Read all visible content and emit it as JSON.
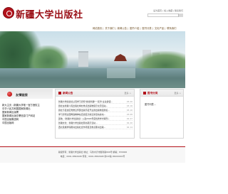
{
  "header": {
    "logo_text": "新疆大学出版社",
    "top_links": "设为首页 | 加入收藏 | 联系我们",
    "search_placeholder": ""
  },
  "nav": {
    "items": [
      "网站首页",
      "关于我们",
      "新闻公告",
      "图书介绍",
      "图书分类",
      "文化产品",
      "联系我们"
    ]
  },
  "left": {
    "title": "友情链接",
    "links": [
      "新大主页（新疆大学唯一官方授权主",
      "中华人民共和国国家新闻出",
      "国家新闻出版署",
      "国家新闻出版总署信息门户网站",
      "中国出版集团网",
      "中国出版网"
    ]
  },
  "news": {
    "title": "新闻公告",
    "more": "更多 >",
    "items": [
      {
        "title": "新疆大学出版社认真学习贯彻\"健康新疆\"一系列\"主旨讲话...",
        "date": "03.20"
      },
      {
        "title": "我社在新疆人民出版社举办重点出版物展示交流活动...",
        "date": "03.16"
      },
      {
        "title": "我社与自治区党委宣传部出版局召开主题出版物选题论...",
        "date": "03.10"
      },
      {
        "title": "学习贯彻全国两会精神在自治区高校宣讲活动启动...",
        "date": "03.08"
      },
      {
        "title": "其他：《新疆大学出版社》入选2022年度优秀学术期刊...",
        "date": "02.27"
      },
      {
        "title": "新疆文化：新疆大学出版社图书展示活动...",
        "date": "02.20"
      },
      {
        "title": "西北民族学院图书出版社合作项目及重点图书出版...",
        "date": "02.14"
      }
    ]
  },
  "books": {
    "title": "图书分类",
    "more": "更多 >",
    "body": "图书列表..."
  },
  "footer": {
    "line1": "版权所有：新疆大学出版社   地址：乌鲁木齐市胜利路666号   邮编：830046",
    "line2": "电话：0991-8582608   传真：0991-8582608   新ICP备 05000001号"
  },
  "colors": {
    "brand": "#b3121b"
  }
}
